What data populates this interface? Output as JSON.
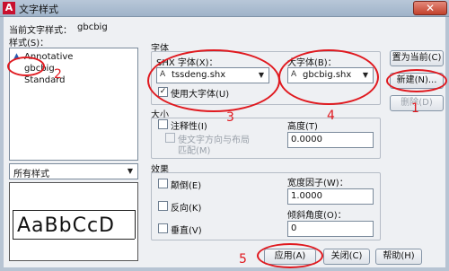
{
  "window": {
    "title": "文字样式",
    "icon_letter": "A",
    "close_glyph": "✕"
  },
  "current_style": {
    "label": "当前文字样式：",
    "value": "gbcbig"
  },
  "styles": {
    "label": "样式(S)：",
    "items": [
      "Annotative",
      "gbcbig",
      "Standard"
    ],
    "filter_value": "所有样式",
    "preview_text": "AaBbCcD"
  },
  "font": {
    "group_label": "字体",
    "shx_label": "SHX 字体(X)：",
    "shx_value": "tssdeng.shx",
    "use_big_font_label": "使用大字体(U)",
    "big_font_label": "大字体(B)：",
    "big_font_value": "gbcbig.shx",
    "font_icon": "A"
  },
  "size": {
    "group_label": "大小",
    "annotative_label": "注释性(I)",
    "match_orientation_label_1": "使文字方向与布局",
    "match_orientation_label_2": "匹配(M)",
    "height_label": "高度(T)",
    "height_value": "0.0000"
  },
  "effects": {
    "group_label": "效果",
    "upside_down_label": "颠倒(E)",
    "backwards_label": "反向(K)",
    "vertical_label": "垂直(V)",
    "width_factor_label": "宽度因子(W)：",
    "width_factor_value": "1.0000",
    "oblique_label": "倾斜角度(O)：",
    "oblique_value": "0"
  },
  "buttons": {
    "set_current": "置为当前(C)",
    "new": "新建(N)...",
    "delete": "删除(D)",
    "apply": "应用(A)",
    "close": "关闭(C)",
    "help": "帮助(H)"
  },
  "annotations": {
    "n1": "1",
    "n2": "2",
    "n3": "3",
    "n4": "4",
    "n5": "5"
  },
  "colors": {
    "annotation": "#e0191f",
    "dialog_bg": "#eef0f3"
  }
}
